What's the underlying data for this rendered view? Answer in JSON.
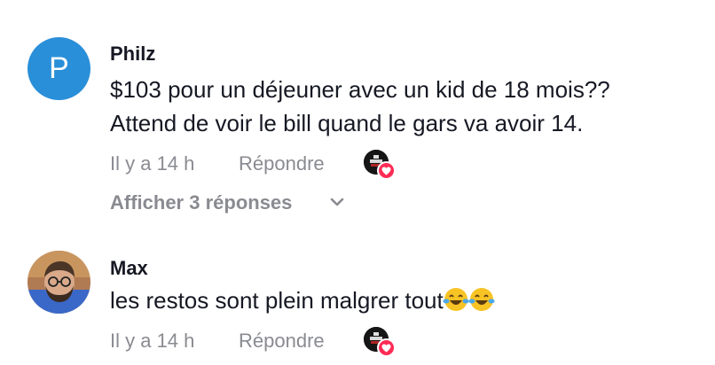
{
  "comments": [
    {
      "avatar_letter": "P",
      "username": "Philz",
      "lines": [
        "$103 pour un déjeuner avec un kid de 18 mois??",
        "Attend de voir le bill quand le gars va avoir 14."
      ],
      "time": "Il y a 14 h",
      "reply_label": "Répondre",
      "view_replies_label": "Afficher 3 réponses"
    },
    {
      "username": "Max",
      "text": "les restos sont plein malgrer tout",
      "emoji": "😂😂",
      "time": "Il y a 14 h",
      "reply_label": "Répondre"
    }
  ],
  "colors": {
    "avatar_blue": "#2a8fd9",
    "text_primary": "#161823",
    "text_secondary": "#8a8b91",
    "heart_red": "#fe2c55"
  },
  "icons": {
    "chevron": "chevron-down-icon",
    "heart": "heart-icon",
    "emoji": "tears-of-joy-emoji"
  }
}
